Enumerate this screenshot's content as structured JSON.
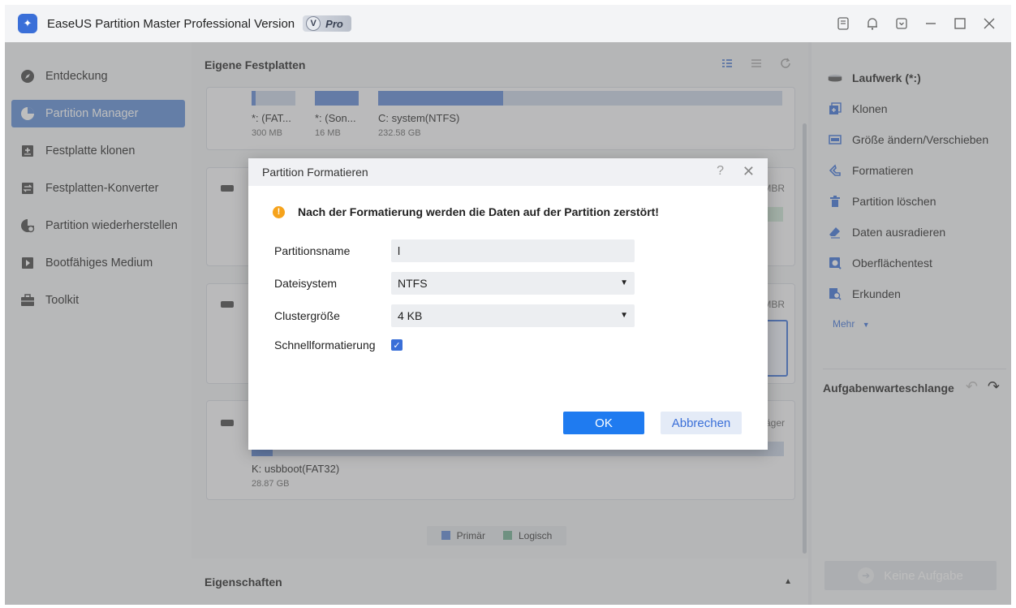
{
  "window": {
    "title": "EaseUS Partition Master Professional Version",
    "badge_v": "V",
    "badge_label": "Pro"
  },
  "sidebar": {
    "items": [
      {
        "label": "Entdeckung",
        "icon": "compass-icon"
      },
      {
        "label": "Partition Manager",
        "icon": "pie-chart-icon",
        "active": true
      },
      {
        "label": "Festplatte klonen",
        "icon": "clone-disk-icon"
      },
      {
        "label": "Festplatten-Konverter",
        "icon": "convert-icon"
      },
      {
        "label": "Partition wiederherstellen",
        "icon": "recover-icon"
      },
      {
        "label": "Bootfähiges Medium",
        "icon": "boot-media-icon"
      },
      {
        "label": "Toolkit",
        "icon": "toolbox-icon"
      }
    ]
  },
  "center": {
    "title": "Eigene Festplatten",
    "disk1": {
      "partitions": [
        {
          "label": "*: (FAT...",
          "size": "300 MB",
          "fill": 0.1
        },
        {
          "label": "*: (Son...",
          "size": "16 MB",
          "fill": 1.0
        },
        {
          "label": "C: system(NTFS)",
          "size": "232.58 GB",
          "fill": 0.31
        }
      ]
    },
    "disk2": {
      "type_hint": "MBR"
    },
    "disk3": {
      "type_hint": "MBR"
    },
    "disk4": {
      "type_hint": "äger",
      "partition_label": "K: usbboot(FAT32)",
      "partition_size": "28.87 GB",
      "fill": 0.04
    },
    "legend": {
      "primary": "Primär",
      "logical": "Logisch",
      "primary_color": "#5b86d3",
      "logical_color": "#6fae91"
    },
    "properties_title": "Eigenschaften"
  },
  "right": {
    "drive_title": "Laufwerk (*:)",
    "actions": [
      {
        "label": "Klonen",
        "icon": "clone-icon"
      },
      {
        "label": "Größe ändern/Verschieben",
        "icon": "resize-icon"
      },
      {
        "label": "Formatieren",
        "icon": "format-icon"
      },
      {
        "label": "Partition löschen",
        "icon": "trash-icon"
      },
      {
        "label": "Daten ausradieren",
        "icon": "eraser-icon"
      },
      {
        "label": "Oberflächentest",
        "icon": "surface-test-icon"
      },
      {
        "label": "Erkunden",
        "icon": "explore-icon"
      }
    ],
    "more_label": "Mehr",
    "queue_title": "Aufgabenwarteschlange",
    "no_task_label": "Keine Aufgabe"
  },
  "dialog": {
    "title": "Partition Formatieren",
    "help_label": "?",
    "warning": "Nach der Formatierung werden die Daten auf der Partition zerstört!",
    "partition_name_label": "Partitionsname",
    "partition_name_value": "l",
    "filesystem_label": "Dateisystem",
    "filesystem_value": "NTFS",
    "cluster_label": "Clustergröße",
    "cluster_value": "4 KB",
    "quick_format_label": "Schnellformatierung",
    "quick_format_checked": true,
    "ok_label": "OK",
    "cancel_label": "Abbrechen"
  }
}
